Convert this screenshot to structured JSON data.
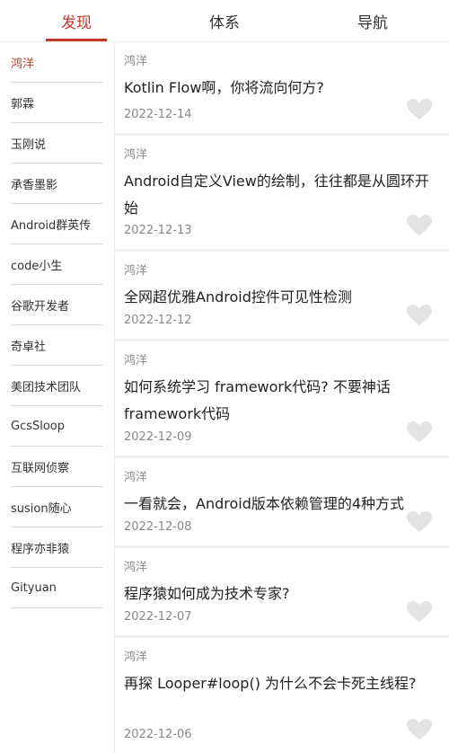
{
  "tabs": [
    {
      "label": "发现",
      "active": true
    },
    {
      "label": "体系",
      "active": false
    },
    {
      "label": "导航",
      "active": false
    }
  ],
  "sidebar": {
    "items": [
      {
        "label": "鸿洋",
        "active": true
      },
      {
        "label": "郭霖",
        "active": false
      },
      {
        "label": "玉刚说",
        "active": false
      },
      {
        "label": "承香墨影",
        "active": false
      },
      {
        "label": "Android群英传",
        "active": false
      },
      {
        "label": "code小生",
        "active": false
      },
      {
        "label": "谷歌开发者",
        "active": false
      },
      {
        "label": "奇卓社",
        "active": false
      },
      {
        "label": "美团技术团队",
        "active": false
      },
      {
        "label": "GcsSloop",
        "active": false
      },
      {
        "label": "互联网侦察",
        "active": false
      },
      {
        "label": "susion随心",
        "active": false
      },
      {
        "label": "程序亦非猿",
        "active": false
      },
      {
        "label": "Gityuan",
        "active": false
      }
    ]
  },
  "articles": [
    {
      "author": "鸿洋",
      "title": "Kotlin Flow啊，你将流向何方?",
      "date": "2022-12-14",
      "liked": false
    },
    {
      "author": "鸿洋",
      "title": "Android自定义View的绘制，往往都是从圆环开始",
      "date": "2022-12-13",
      "liked": false
    },
    {
      "author": "鸿洋",
      "title": "全网超优雅Android控件可见性检测",
      "date": "2022-12-12",
      "liked": false
    },
    {
      "author": "鸿洋",
      "title": "如何系统学习 framework代码? 不要神话framework代码",
      "date": "2022-12-09",
      "liked": false
    },
    {
      "author": "鸿洋",
      "title": "一看就会，Android版本依赖管理的4种方式",
      "date": "2022-12-08",
      "liked": false
    },
    {
      "author": "鸿洋",
      "title": "程序猿如何成为技术专家?",
      "date": "2022-12-07",
      "liked": false
    },
    {
      "author": "鸿洋",
      "title": "再探 Looper#loop() 为什么不会卡死主线程?",
      "date": "2022-12-06",
      "liked": false
    }
  ],
  "colors": {
    "accent": "#c0392b",
    "heart_inactive": "#e3e3e3"
  },
  "icons": {
    "like": "heart-icon"
  }
}
